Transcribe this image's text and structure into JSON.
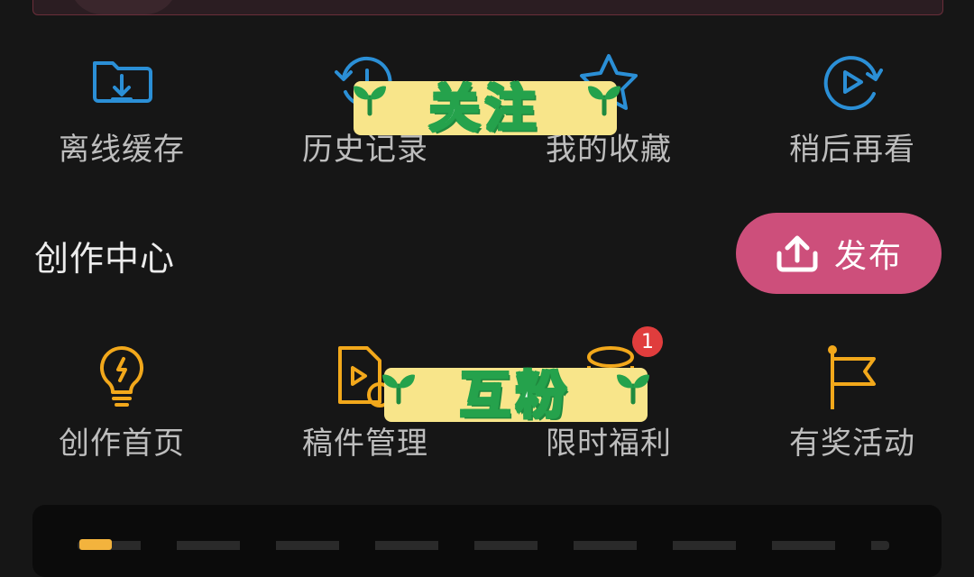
{
  "menu_row_1": [
    {
      "label": "离线缓存",
      "icon": "download-folder-icon"
    },
    {
      "label": "历史记录",
      "icon": "history-clock-icon"
    },
    {
      "label": "我的收藏",
      "icon": "star-icon"
    },
    {
      "label": "稍后再看",
      "icon": "play-later-icon"
    }
  ],
  "creation": {
    "title": "创作中心",
    "publish_label": "发布",
    "publish_icon": "upload-icon"
  },
  "menu_row_2": [
    {
      "label": "创作首页",
      "icon": "lightbulb-icon"
    },
    {
      "label": "稿件管理",
      "icon": "document-play-icon"
    },
    {
      "label": "限时福利",
      "icon": "gift-icon",
      "badge": "1"
    },
    {
      "label": "有奖活动",
      "icon": "flag-icon"
    }
  ],
  "stickers": {
    "follow": "关注",
    "mutual": "互粉"
  },
  "colors": {
    "background": "#161616",
    "row1_icon": "#2b8fd6",
    "row2_icon": "#f2a81b",
    "publish": "#cd4f7b",
    "badge": "#e03d3d",
    "sticker_bg": "#f8e58a",
    "sticker_text_outline": "#25a24c"
  }
}
